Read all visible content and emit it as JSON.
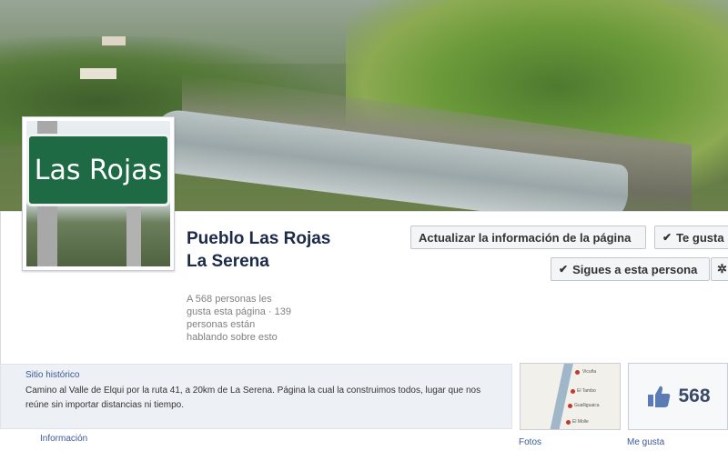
{
  "cover": {
    "alt": ""
  },
  "profile": {
    "sign_text": "Las Rojas"
  },
  "page": {
    "name": "Pueblo Las Rojas La Serena",
    "stats": "A 568 personas les gusta esta página · 139 personas están hablando sobre esto"
  },
  "actions": {
    "update_label": "Actualizar la información de la página",
    "like_label": "Te gusta",
    "follow_label": "Sigues a esta persona",
    "gear_icon": "gear-icon",
    "check_icon": "check-icon"
  },
  "about": {
    "category": "Sitio histórico",
    "description": "Camino al Valle de Elqui por la ruta 41, a 20km de La Serena. Página la cual la construimos todos, lugar que nos reúne sin importar distancias ni tiempo.",
    "link_label": "Información"
  },
  "photos": {
    "label": "Fotos",
    "map_labels": [
      "Vicuña",
      "El Tambo",
      "Gualliguaica",
      "El Molle"
    ]
  },
  "likes": {
    "count": "568",
    "label": "Me gusta",
    "icon": "thumbs-up-icon"
  },
  "colors": {
    "link": "#3b5998",
    "name": "#1c2a47",
    "sign_green": "#1d6a45"
  }
}
